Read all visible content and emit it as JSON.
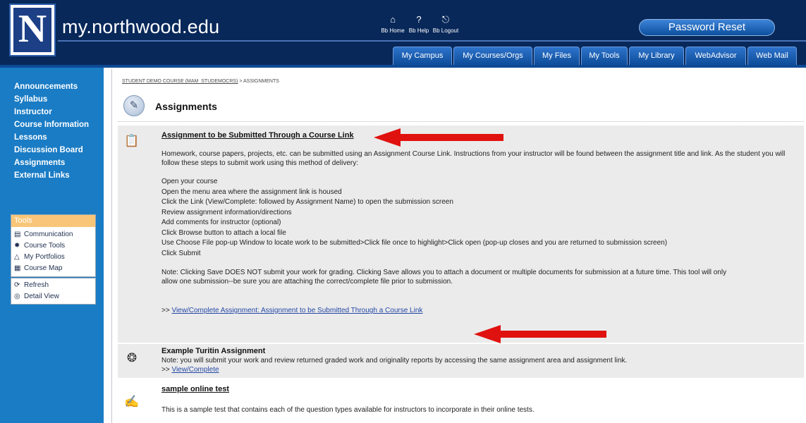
{
  "header": {
    "site_name": "my.northwood.edu",
    "logo_letter": "N",
    "bb_links": [
      {
        "label": "Bb Home",
        "icon": "home-icon"
      },
      {
        "label": "Bb Help",
        "icon": "help-icon"
      },
      {
        "label": "Bb Logout",
        "icon": "logout-icon"
      }
    ],
    "password_reset": "Password Reset"
  },
  "tabs": [
    "My Campus",
    "My Courses/Orgs",
    "My Files",
    "My Tools",
    "My Library",
    "WebAdvisor",
    "Web Mail"
  ],
  "sidebar": {
    "nav": [
      "Announcements",
      "Syllabus",
      "Instructor",
      "Course Information",
      "Lessons",
      "Discussion Board",
      "Assignments",
      "External Links"
    ],
    "tools_title": "Tools",
    "tools": [
      {
        "label": "Communication",
        "icon": "communication-icon"
      },
      {
        "label": "Course Tools",
        "icon": "tools-icon"
      },
      {
        "label": "My Portfolios",
        "icon": "portfolio-icon"
      },
      {
        "label": "Course Map",
        "icon": "map-icon"
      }
    ],
    "views": [
      {
        "label": "Refresh",
        "icon": "refresh-icon"
      },
      {
        "label": "Detail View",
        "icon": "detail-view-icon"
      }
    ]
  },
  "content": {
    "breadcrumb_course": "STUDENT DEMO COURSE (MAM_STUDEMOCRS)",
    "breadcrumb_sep": " > ",
    "breadcrumb_page": "ASSIGNMENTS",
    "page_title": "Assignments",
    "item1": {
      "title": "Assignment to be Submitted Through a Course Link",
      "intro": "Homework, course papers, projects, etc. can be submitted using an Assignment Course Link.  Instructions from your instructor will be found between the assignment title and link.  As the student you will follow these steps to submit work using this method of delivery:",
      "steps": [
        "Open your course",
        "Open the menu area where the assignment link is housed",
        "Click the Link (View/Complete: followed by Assignment Name) to open the submission screen",
        "Review assignment information/directions",
        "Add comments for instructor (optional)",
        "Click Browse button to attach a local file",
        "Use Choose File pop-up Window to locate work to be submitted>Click file once to highlight>Click open (pop-up closes and you are returned to submission screen)",
        "Click Submit"
      ],
      "note": "Note:  Clicking Save DOES NOT submit your work for grading.  Clicking Save allows you to attach a document or multiple documents for submission at a future time. This tool will only allow one submission--be sure you are attaching the correct/complete file prior to submission.",
      "link_prefix": ">> ",
      "link": "View/Complete Assignment: Assignment to be Submitted Through a Course Link"
    },
    "item2": {
      "title": "Example Turitin Assignment",
      "note": "Note: you will submit your work and review returned graded work and originality reports by accessing the same assignment area and assignment link.",
      "link_prefix": ">> ",
      "link": "View/Complete"
    },
    "item3": {
      "title": "sample online test",
      "text": "This is a sample test that contains each of the question types available for instructors to incorporate in their online tests."
    }
  },
  "colors": {
    "header_bg": "#08285a",
    "sidebar_bg": "#1a7cc5",
    "annotation_arrow": "#e0120f",
    "link": "#2448a6"
  }
}
